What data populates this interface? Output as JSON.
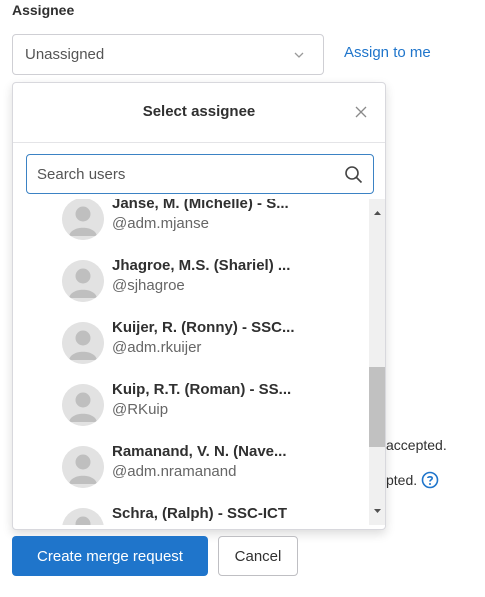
{
  "field_label": "Assignee",
  "assignee_select": {
    "value": "Unassigned",
    "icon": "chevron-down-icon"
  },
  "assign_to_me": "Assign to me",
  "background_text": {
    "accepted": "accepted.",
    "pted": "pted."
  },
  "dropdown": {
    "title": "Select assignee",
    "search": {
      "placeholder": "Search users",
      "value": ""
    },
    "users": [
      {
        "name": "Janse, M. (Michelle) - S...",
        "handle": "@adm.mjanse"
      },
      {
        "name": "Jhagroe, M.S. (Shariel) ...",
        "handle": "@sjhagroe"
      },
      {
        "name": "Kuijer, R. (Ronny) - SSC...",
        "handle": "@adm.rkuijer"
      },
      {
        "name": "Kuip, R.T. (Roman) - SS...",
        "handle": "@RKuip"
      },
      {
        "name": "Ramanand, V. N. (Nave...",
        "handle": "@adm.nramanand"
      },
      {
        "name": "Schra, (Ralph) - SSC-ICT",
        "handle": ""
      }
    ]
  },
  "buttons": {
    "create": "Create merge request",
    "cancel": "Cancel"
  },
  "colors": {
    "primary": "#1f75cb",
    "link": "#1f75cb",
    "focus_border": "#3b82c4"
  }
}
